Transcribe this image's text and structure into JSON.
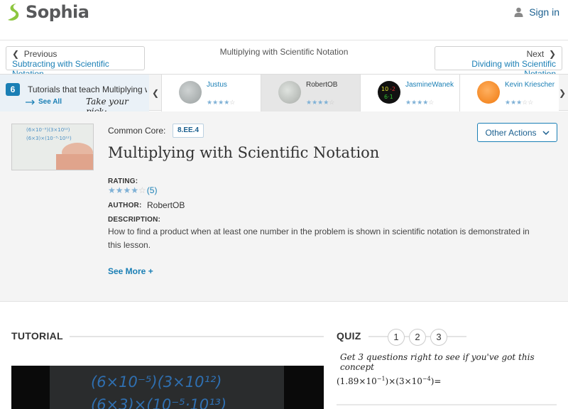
{
  "header": {
    "logo_text": "Sophia",
    "signin_label": "Sign in"
  },
  "nav": {
    "prev_label": "Previous",
    "prev_title": "Subtracting with Scientific Notation",
    "current_title": "Multiplying with Scientific Notation",
    "next_label": "Next",
    "next_title": "Dividing with Scientific Notation"
  },
  "tutorials_strip": {
    "count": "6",
    "title": "Tutorials that teach Multiplying with Scientific Notation",
    "see_all": "See All",
    "take_pick": "Take your pick:",
    "cards": [
      {
        "name": "Justus",
        "rating": 4
      },
      {
        "name": "RobertOB",
        "rating": 4,
        "selected": true
      },
      {
        "name": "JasmineWanek",
        "rating": 4
      },
      {
        "name": "Kevin Kriescher",
        "rating": 3
      }
    ]
  },
  "info": {
    "common_core_label": "Common Core:",
    "common_core_code": "8.EE.4",
    "other_actions": "Other Actions",
    "title": "Multiplying with Scientific Notation",
    "rating_label": "RATING:",
    "rating_value": 4,
    "rating_count": "(5)",
    "author_label": "AUTHOR:",
    "author_value": "RobertOB",
    "description_label": "DESCRIPTION:",
    "description": "How to find a product when at least one number in the problem is shown in scientific notation is demonstrated in this lesson.",
    "see_more": "See More +"
  },
  "tutorial": {
    "heading": "TUTORIAL"
  },
  "quiz": {
    "heading": "QUIZ",
    "numbers": [
      "1",
      "2",
      "3"
    ],
    "prompt": "Get 3 questions right to see if you've got this concept",
    "question_a": "(1.89×10",
    "question_a_exp": "−1",
    "question_b": ")×(3×10",
    "question_b_exp": "−4",
    "question_c": ")="
  },
  "colors": {
    "brand_blue": "#1a7fb5",
    "logo_green": "#8dc63f",
    "star_on": "#7fb1d6",
    "star_off": "#c5c5c5"
  }
}
